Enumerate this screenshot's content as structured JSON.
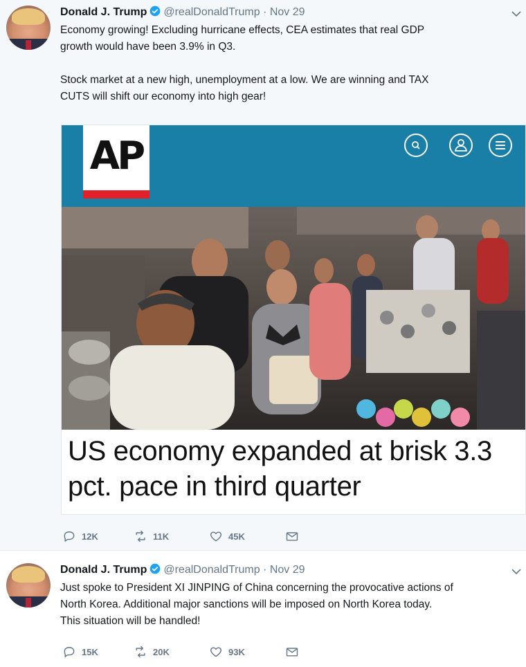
{
  "tweets": [
    {
      "author_name": "Donald J. Trump",
      "handle": "@realDonaldTrump",
      "separator": "·",
      "date": "Nov 29",
      "text_lines": [
        "Economy growing! Excluding hurricane effects, CEA estimates that real GDP",
        "growth would have been 3.9% in Q3.",
        "",
        "Stock market at a new high, unemployment at a low. We are winning and TAX",
        "CUTS will shift our economy into high gear!"
      ],
      "card": {
        "logo_text": "AP",
        "header_icons": [
          "search-icon",
          "user-icon",
          "menu-icon"
        ],
        "headline_lines": [
          "US economy expanded at brisk 3.3",
          "pct. pace in third quarter"
        ]
      },
      "replies": "12K",
      "retweets": "11K",
      "likes": "45K"
    },
    {
      "author_name": "Donald J. Trump",
      "handle": "@realDonaldTrump",
      "separator": "·",
      "date": "Nov 29",
      "text_lines": [
        "Just spoke to President XI JINPING of China concerning the provocative actions of",
        "North Korea. Additional major sanctions will be imposed on North Korea today.",
        "This situation will be handled!"
      ],
      "replies": "15K",
      "retweets": "20K",
      "likes": "93K"
    }
  ],
  "colors": {
    "ap_blue": "#1a7fa6",
    "ap_red": "#e2202a",
    "verified_blue": "#1da1f2",
    "muted_text": "#657786"
  }
}
